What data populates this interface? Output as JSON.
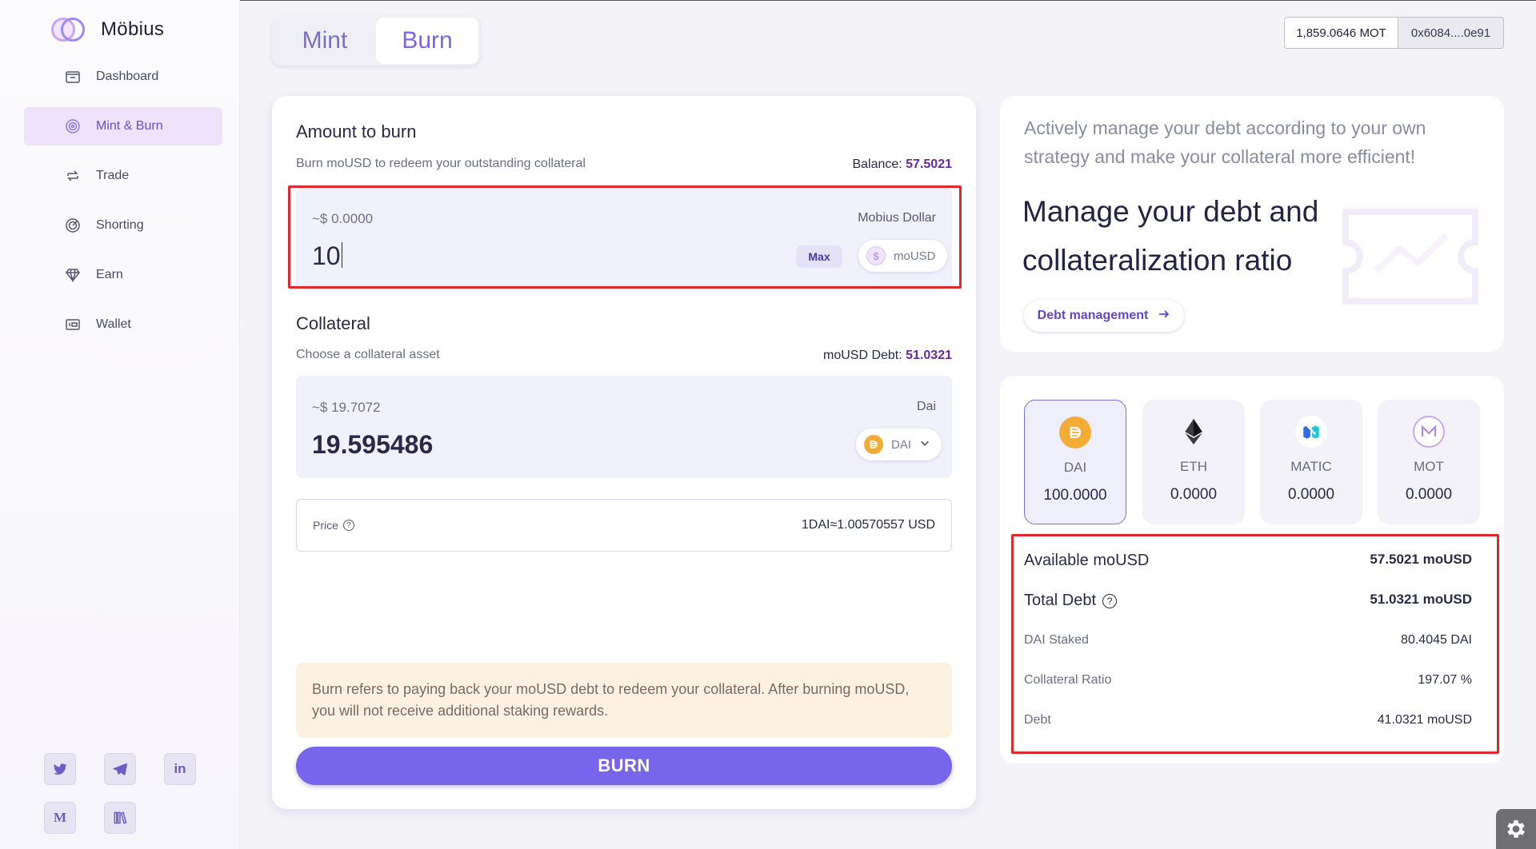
{
  "app": {
    "name": "Möbius"
  },
  "sidebar": {
    "items": [
      {
        "label": "Dashboard",
        "icon": "dashboard-icon"
      },
      {
        "label": "Mint & Burn",
        "icon": "mint-burn-icon",
        "active": true
      },
      {
        "label": "Trade",
        "icon": "trade-icon"
      },
      {
        "label": "Shorting",
        "icon": "target-icon"
      },
      {
        "label": "Earn",
        "icon": "diamond-icon"
      },
      {
        "label": "Wallet",
        "icon": "wallet-icon"
      }
    ],
    "socials": [
      {
        "name": "twitter-icon"
      },
      {
        "name": "telegram-icon"
      },
      {
        "name": "linkedin-icon",
        "label": "in"
      },
      {
        "name": "medium-icon",
        "label": "M"
      },
      {
        "name": "docs-icon"
      }
    ]
  },
  "header": {
    "tabs": [
      {
        "label": "Mint"
      },
      {
        "label": "Burn",
        "active": true
      }
    ],
    "balance": "1,859.0646 MOT",
    "address": "0x6084....0e91"
  },
  "burn_card": {
    "amount": {
      "title": "Amount to burn",
      "subtitle": "Burn moUSD to redeem your outstanding collateral",
      "balance_label": "Balance:",
      "balance_value": "57.5021",
      "usd": "~$ 0.0000",
      "asset_name": "Mobius Dollar",
      "value": "10",
      "max_label": "Max",
      "token": "moUSD"
    },
    "collateral": {
      "title": "Collateral",
      "subtitle": "Choose a collateral asset",
      "debt_label": "moUSD Debt:",
      "debt_value": "51.0321",
      "usd": "~$ 19.7072",
      "asset_name": "Dai",
      "value": "19.595486",
      "token": "DAI"
    },
    "price": {
      "label": "Price",
      "value": "1DAI≈1.00570557 USD"
    },
    "notice": "Burn refers to paying back your moUSD debt to redeem your collateral. After burning moUSD, you will not receive additional staking rewards.",
    "burn_label": "BURN"
  },
  "promo": {
    "lead": "Actively manage your debt according to your own strategy and make your collateral more efficient!",
    "headline": "Manage your debt and collateralization ratio",
    "button": "Debt management"
  },
  "assets": {
    "tiles": [
      {
        "name": "DAI",
        "amount": "100.0000",
        "active": true
      },
      {
        "name": "ETH",
        "amount": "0.0000"
      },
      {
        "name": "MATIC",
        "amount": "0.0000"
      },
      {
        "name": "MOT",
        "amount": "0.0000"
      }
    ],
    "stats": [
      {
        "label": "Available moUSD",
        "value": "57.5021 moUSD"
      },
      {
        "label": "Total Debt",
        "value": "51.0321 moUSD"
      },
      {
        "label": "DAI Staked",
        "value": "80.4045 DAI"
      },
      {
        "label": "Collateral Ratio",
        "value": "197.07 %"
      },
      {
        "label": "Debt",
        "value": "41.0321 moUSD"
      }
    ]
  },
  "colors": {
    "accent": "#7765ec",
    "highlight": "#e0272b",
    "dai": "#f5ac37"
  }
}
